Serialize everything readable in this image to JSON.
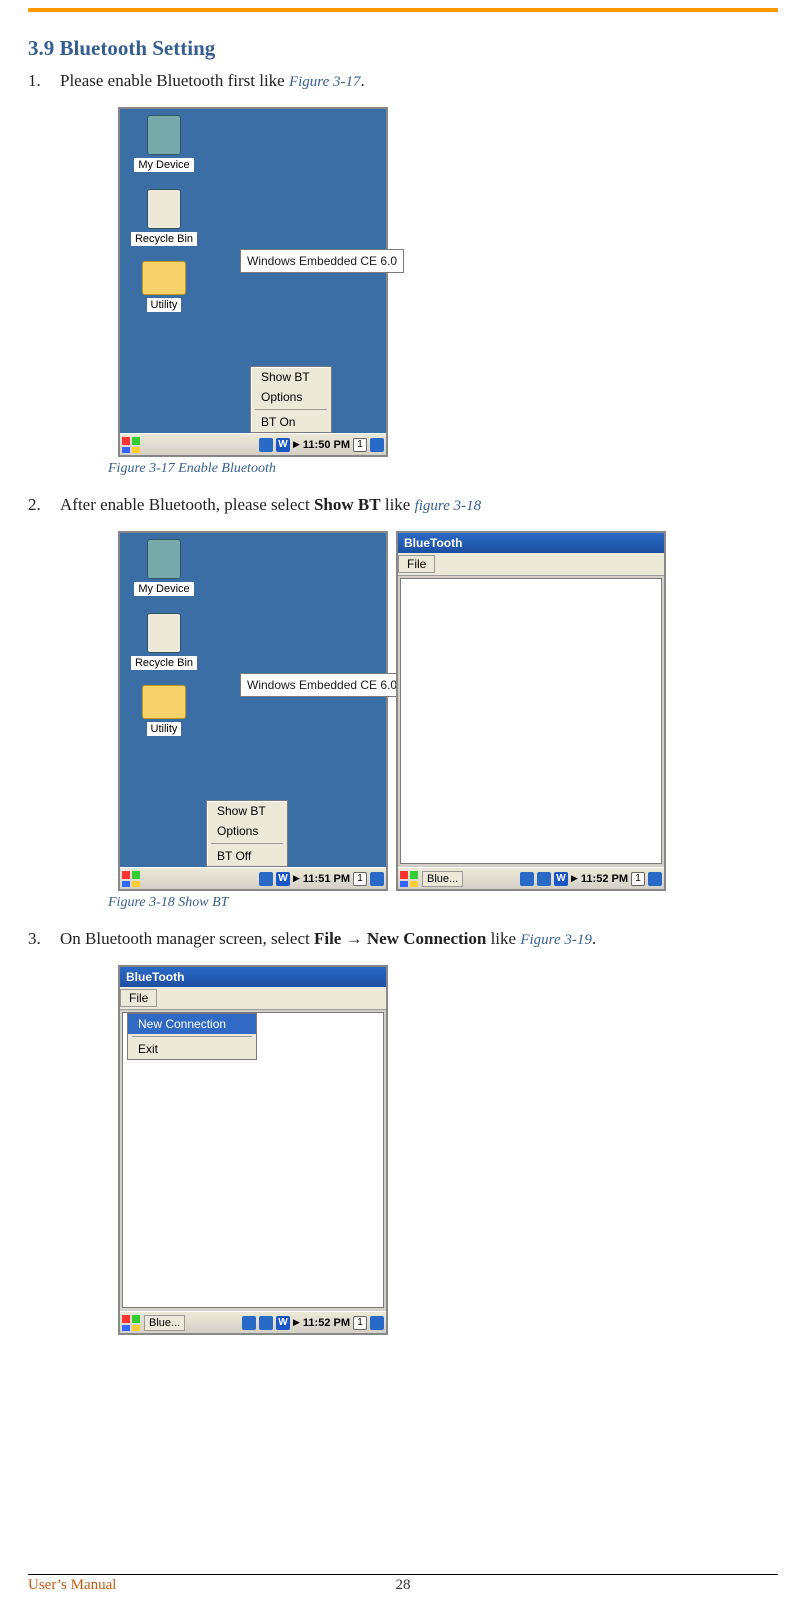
{
  "heading": "3.9  Bluetooth Setting",
  "steps": {
    "s1": {
      "num": "1.",
      "text_a": "Please enable Bluetooth first like ",
      "ref": "Figure 3-17",
      "text_b": "."
    },
    "s2": {
      "num": "2.",
      "text_a": "After enable Bluetooth, please select ",
      "bold": "Show BT",
      "text_b": "  like ",
      "ref": "figure 3-18"
    },
    "s3": {
      "num": "3.",
      "text_a": "On Bluetooth manager screen, select ",
      "bold1": "File",
      "arrow": " → ",
      "bold2": "New Connection",
      "text_b": " like ",
      "ref": "Figure 3-19",
      "text_c": "."
    }
  },
  "captions": {
    "c1": "Figure 3-17 Enable Bluetooth",
    "c2": "Figure 3-18 Show BT"
  },
  "desktop": {
    "my_device": "My Device",
    "recycle": "Recycle Bin",
    "utility": "Utility",
    "splash": "Windows Embedded CE 6.0"
  },
  "menu1": {
    "line1": "Show BT",
    "line2": "Options",
    "bt_on": "BT On",
    "bt_off": "BT Off"
  },
  "bt_window": {
    "title": "BlueTooth",
    "file": "File",
    "new_conn": "New Connection",
    "exit": "Exit"
  },
  "taskbar": {
    "blue_btn": "Blue...",
    "clock1": "11:50 PM",
    "clock2": "11:51 PM",
    "clock3": "11:52 PM",
    "one": "1",
    "w": "W"
  },
  "footer": {
    "left": "User’s Manual",
    "page": "28"
  }
}
